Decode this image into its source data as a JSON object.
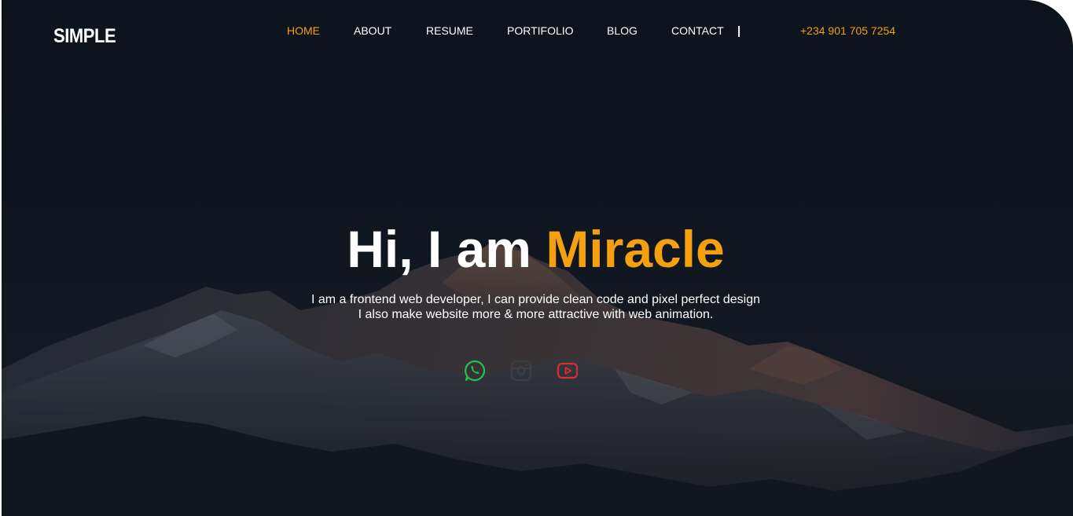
{
  "brand": {
    "logo": "SIMPLE"
  },
  "nav": {
    "items": [
      {
        "label": "HOME",
        "active": true
      },
      {
        "label": "ABOUT",
        "active": false
      },
      {
        "label": "RESUME",
        "active": false
      },
      {
        "label": "PORTIFOLIO",
        "active": false
      },
      {
        "label": "BLOG",
        "active": false
      },
      {
        "label": "CONTACT",
        "active": false
      }
    ],
    "separator": "|",
    "phone": "+234 901 705 7254"
  },
  "hero": {
    "greeting": "Hi, I am",
    "name": "Miracle",
    "line1": "I am a frontend web developer, I can provide clean code and pixel perfect design",
    "line2": "I also make website more & more attractive with web animation."
  },
  "socials": [
    {
      "icon": "whatsapp-icon",
      "color": "#25c04a"
    },
    {
      "icon": "instagram-icon",
      "color": "#3a3f46"
    },
    {
      "icon": "youtube-icon",
      "color": "#d8302c"
    }
  ],
  "colors": {
    "accent": "#f5a00e",
    "background": "#141b26",
    "text": "#ffffff"
  }
}
